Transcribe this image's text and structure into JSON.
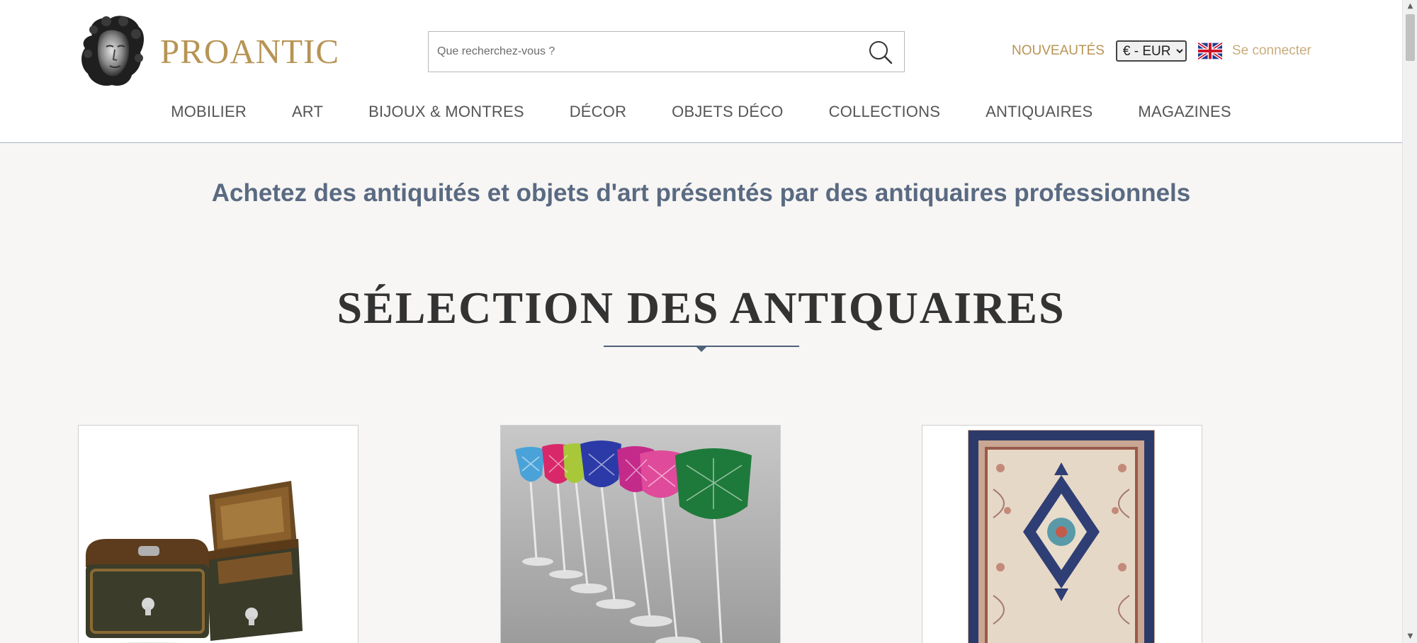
{
  "header": {
    "logo_text": "PROANTIC",
    "search": {
      "placeholder": "Que recherchez-vous ?"
    },
    "new_label": "NOUVEAUTÉS",
    "currency_selected": "€ - EUR",
    "login_label": "Se connecter",
    "language_flag": "uk-flag-icon"
  },
  "nav": {
    "items": [
      {
        "label": "MOBILIER"
      },
      {
        "label": "ART"
      },
      {
        "label": "BIJOUX & MONTRES"
      },
      {
        "label": "DÉCOR"
      },
      {
        "label": "OBJETS DÉCO"
      },
      {
        "label": "COLLECTIONS"
      },
      {
        "label": "ANTIQUAIRES"
      },
      {
        "label": "MAGAZINES"
      }
    ]
  },
  "main": {
    "tagline": "Achetez des antiquités et objets d'art présentés par des antiquaires professionnels",
    "section_title": "SÉLECTION DES ANTIQUAIRES",
    "cards": [
      {
        "image": "inlaid-wooden-boxes-photo"
      },
      {
        "image": "colored-crystal-wine-glasses-photo"
      },
      {
        "image": "persian-rug-photo"
      }
    ]
  },
  "colors": {
    "brand_gold": "#b79454",
    "tagline_blue": "#5a6a82",
    "background": "#f7f6f4"
  }
}
